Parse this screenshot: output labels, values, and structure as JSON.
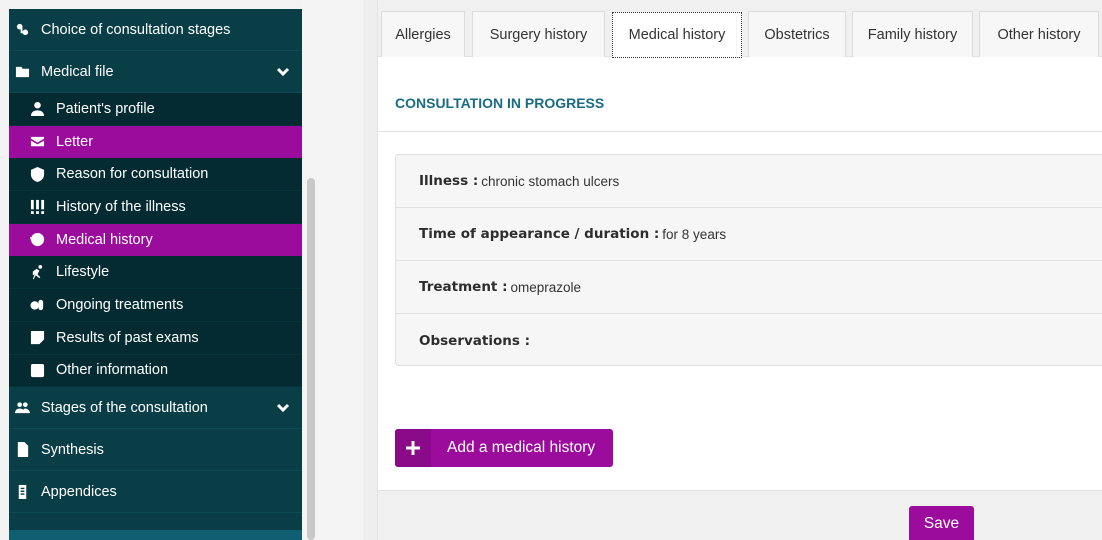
{
  "sidebar": {
    "items": [
      {
        "label": "Choice of consultation stages",
        "icon": "stethoscope-icon"
      },
      {
        "label": "Medical file",
        "icon": "folder-medical-icon",
        "expanded": true
      },
      {
        "label": "Patient's profile",
        "icon": "user-icon"
      },
      {
        "label": "Letter",
        "icon": "envelope-icon",
        "active": true
      },
      {
        "label": "Reason for consultation",
        "icon": "shield-question-icon"
      },
      {
        "label": "History of the illness",
        "icon": "exclamation-triple-icon"
      },
      {
        "label": "Medical history",
        "icon": "history-icon",
        "active": true
      },
      {
        "label": "Lifestyle",
        "icon": "running-icon"
      },
      {
        "label": "Ongoing treatments",
        "icon": "pills-icon"
      },
      {
        "label": "Results of past exams",
        "icon": "report-icon"
      },
      {
        "label": "Other information",
        "icon": "square-icon"
      },
      {
        "label": "Stages of the consultation",
        "icon": "users-icon",
        "expanded": true
      },
      {
        "label": "Synthesis",
        "icon": "file-icon"
      },
      {
        "label": "Appendices",
        "icon": "clipboard-icon"
      }
    ]
  },
  "tabs": [
    {
      "label": "Allergies"
    },
    {
      "label": "Surgery history"
    },
    {
      "label": "Medical history",
      "active": true
    },
    {
      "label": "Obstetrics"
    },
    {
      "label": "Family history"
    },
    {
      "label": "Other history"
    }
  ],
  "main": {
    "section_title": "CONSULTATION IN PROGRESS",
    "rows": [
      {
        "key": "Illness :",
        "value": "chronic stomach ulcers"
      },
      {
        "key": "Time of appearance / duration :",
        "value": "for 8 years"
      },
      {
        "key": "Treatment :",
        "value": "omeprazole"
      },
      {
        "key": "Observations :",
        "value": ""
      }
    ],
    "add_button": "Add a medical history",
    "save_button": "Save"
  },
  "colors": {
    "sidebar_bg": "#0a3e47",
    "sidebar_sub_bg": "#042b32",
    "accent": "#9c0c9c",
    "title": "#1a6c86"
  }
}
